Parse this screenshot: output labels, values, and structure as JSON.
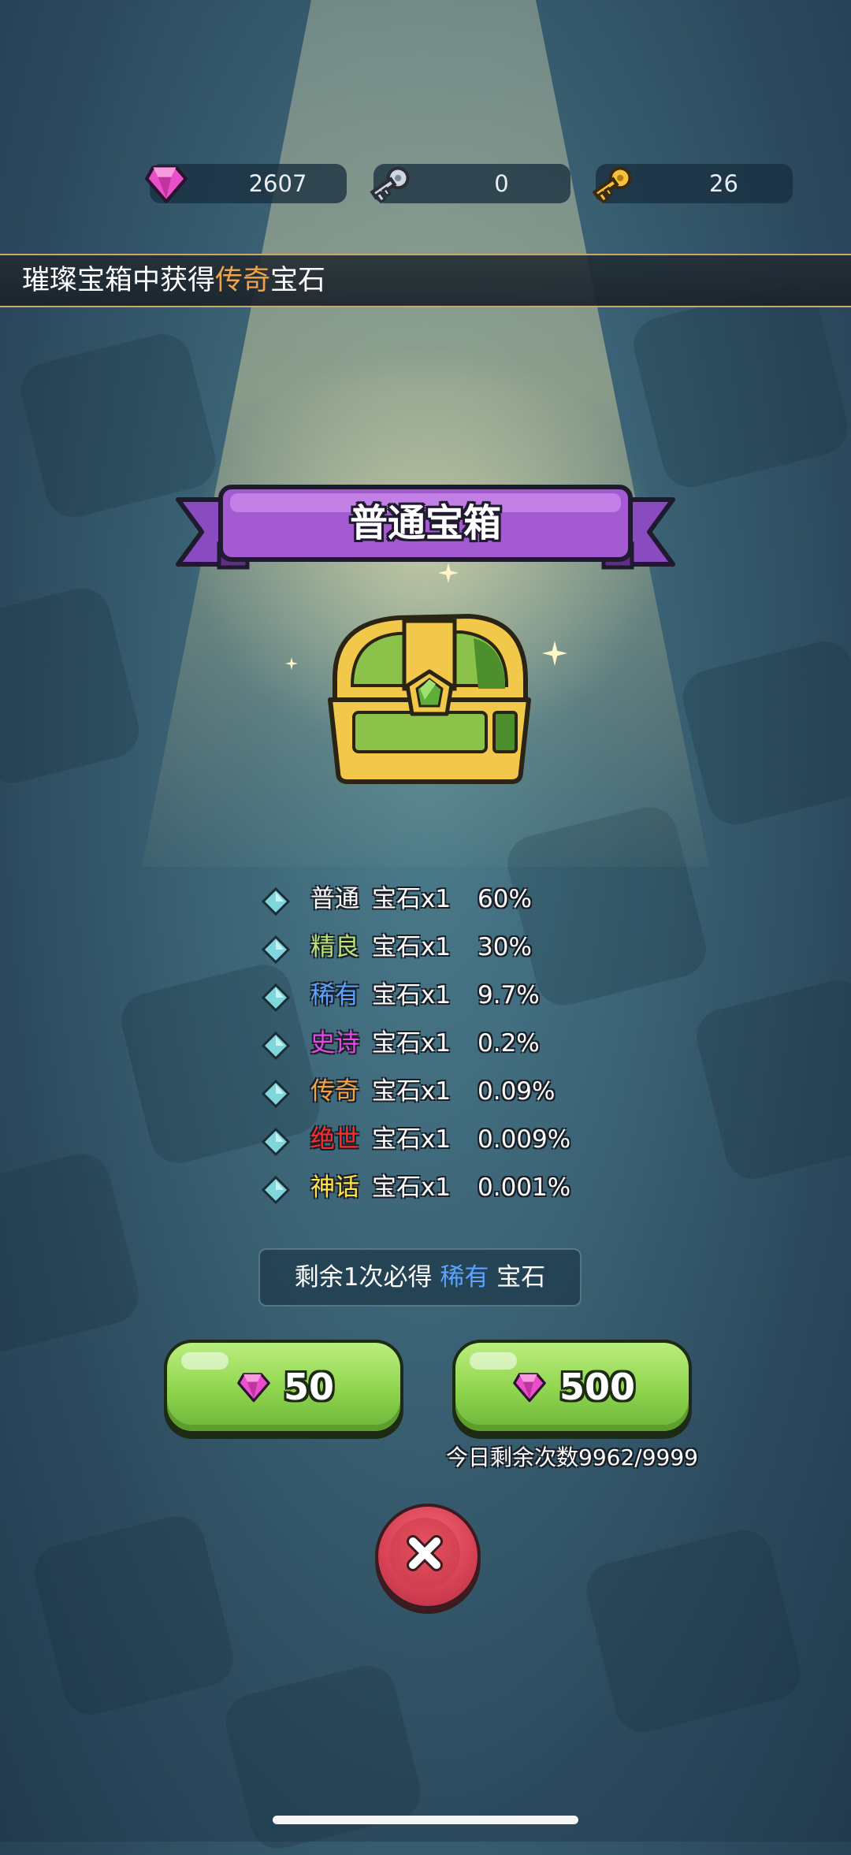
{
  "resources": [
    {
      "name": "gem-resource",
      "value": "2607",
      "icon": "pink-gem-icon"
    },
    {
      "name": "silver-key-resource",
      "value": "0",
      "icon": "silver-key-icon"
    },
    {
      "name": "gold-key-resource",
      "value": "26",
      "icon": "gold-key-icon"
    }
  ],
  "banner": {
    "prefix": "璀璨宝箱中获得",
    "highlight": "传奇",
    "suffix": "宝石",
    "highlight_color": "#f0a347"
  },
  "chest": {
    "title": "普通宝箱",
    "icon": "treasure-chest-icon"
  },
  "odds": [
    {
      "rarity": "普通",
      "item": "宝石x1",
      "percent": "60%",
      "color": "#ffffff"
    },
    {
      "rarity": "精良",
      "item": "宝石x1",
      "percent": "30%",
      "color": "#b9e27a"
    },
    {
      "rarity": "稀有",
      "item": "宝石x1",
      "percent": "9.7%",
      "color": "#5ba3ff"
    },
    {
      "rarity": "史诗",
      "item": "宝石x1",
      "percent": "0.2%",
      "color": "#e14ce6"
    },
    {
      "rarity": "传奇",
      "item": "宝石x1",
      "percent": "0.09%",
      "color": "#f0a347"
    },
    {
      "rarity": "绝世",
      "item": "宝石x1",
      "percent": "0.009%",
      "color": "#ff2b2b"
    },
    {
      "rarity": "神话",
      "item": "宝石x1",
      "percent": "0.001%",
      "color": "#ffe34a"
    }
  ],
  "guarantee": {
    "prefix": "剩余1次必得",
    "highlight": "稀有",
    "suffix": "宝石"
  },
  "buttons": [
    {
      "label": "50",
      "icon": "pink-gem-icon"
    },
    {
      "label": "500",
      "icon": "pink-gem-icon"
    }
  ],
  "daily_remaining": "今日剩余次数9962/9999",
  "close": {
    "icon": "close-icon"
  },
  "colors": {
    "accent_green": "#8fd44d",
    "ribbon_purple": "#a45ad1",
    "close_red": "#d94356"
  }
}
